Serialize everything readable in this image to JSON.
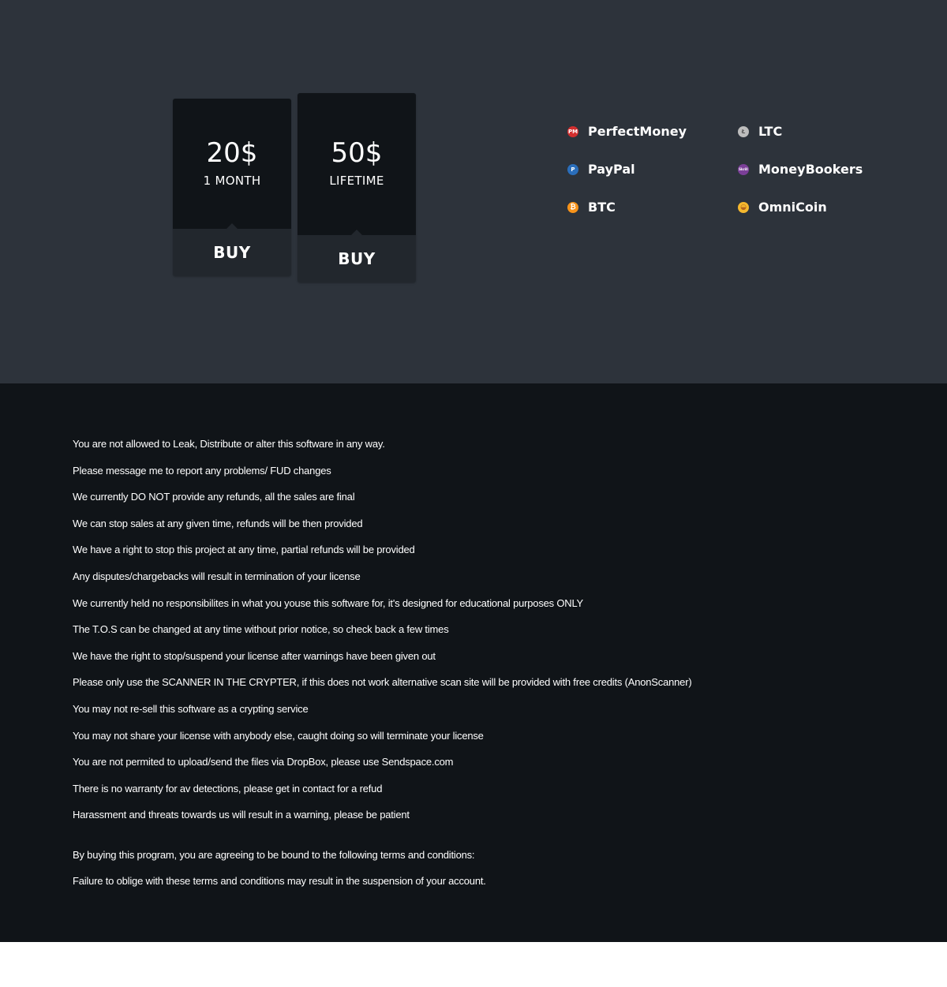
{
  "pricing": [
    {
      "price": "20$",
      "term": "1 MONTH",
      "button": "BUY"
    },
    {
      "price": "50$",
      "term": "LIFETIME",
      "button": "BUY"
    }
  ],
  "payment_methods": [
    {
      "label": "PerfectMoney",
      "icon": "perfectmoney-icon",
      "icon_text": "PM",
      "color": "#d32f2f"
    },
    {
      "label": "LTC",
      "icon": "litecoin-icon",
      "icon_text": "Ł",
      "color": "#bdbdbd"
    },
    {
      "label": "PayPal",
      "icon": "paypal-icon",
      "icon_text": "P",
      "color": "#2a6ebb"
    },
    {
      "label": "MoneyBookers",
      "icon": "skrill-icon",
      "icon_text": "Skrill",
      "color": "#7b3f98"
    },
    {
      "label": "BTC",
      "icon": "bitcoin-icon",
      "icon_text": "₿",
      "color": "#f7931a"
    },
    {
      "label": "OmniCoin",
      "icon": "omnicoin-icon",
      "icon_text": "◒",
      "color": "#f5b82e"
    }
  ],
  "tos": {
    "rules": [
      "You are not allowed to Leak, Distribute or alter this software in any way.",
      "Please message me to report any problems/ FUD changes",
      "We currently DO NOT provide any refunds, all the sales are final",
      "We can stop sales at any given time, refunds will be then provided",
      "We have a right to stop this project at any time, partial refunds will be provided",
      "Any disputes/chargebacks will result in termination of your license",
      "We currently held no responsibilites in what you youse this software for, it's designed for educational purposes ONLY",
      "The T.O.S can be changed at any time without prior notice, so check back a few times",
      "We have the right to stop/suspend your license after warnings have been given out",
      "Please only use the SCANNER IN THE CRYPTER, if this does not work alternative scan site will be provided with free credits (AnonScanner)",
      "You may not re-sell this software as a crypting service",
      "You may not share your license with anybody else, caught doing so will terminate your license",
      "You are not permited to upload/send the files via DropBox, please use Sendspace.com",
      "There is no warranty for av detections, please get in contact for a refud",
      "Harassment and threats towards us will result in a warning, please be patient"
    ],
    "agreement": "By buying this program, you are agreeing to be bound to the following terms and conditions:",
    "failure": "Failure to oblige with these terms and conditions may result in the suspension of your account."
  }
}
